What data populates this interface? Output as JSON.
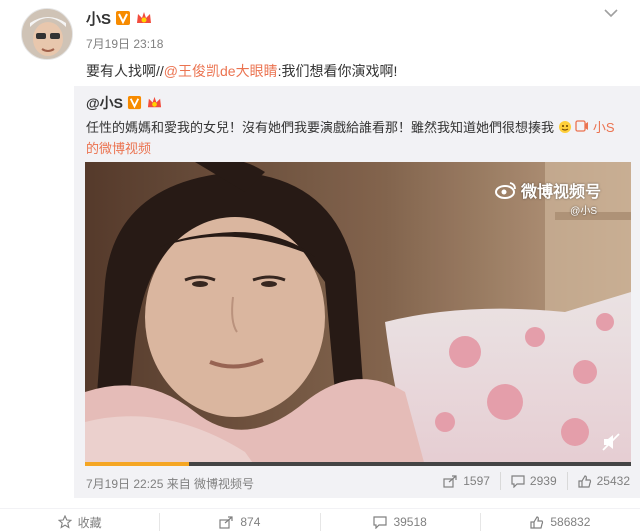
{
  "post": {
    "username": "小S",
    "time": "7月19日 23:18",
    "text_prefix": "要有人找啊//",
    "mention": "@王俊凯de大眼睛",
    "text_suffix": ":我们想看你演戏啊!"
  },
  "repost": {
    "username": "@小S",
    "text": "任性的媽媽和愛我的女兒！沒有她們我要演戲給誰看那！雖然我知道她們很想揍我",
    "video_link_inline": "小S",
    "video_link": "的微博视频",
    "meta": "7月19日 22:25 来自 微博视频号",
    "stats": {
      "shares": "1597",
      "comments": "2939",
      "likes": "25432"
    }
  },
  "video": {
    "watermark": "微博视频号",
    "watermark_sub": "@小S",
    "progress": 0.19
  },
  "actions": {
    "favorite": "收藏",
    "share": "874",
    "comment": "39518",
    "like": "586832"
  },
  "colors": {
    "link": "#eb7350",
    "muted": "#808080",
    "repost_bg": "#f2f2f5",
    "progress": "#f5a623"
  }
}
